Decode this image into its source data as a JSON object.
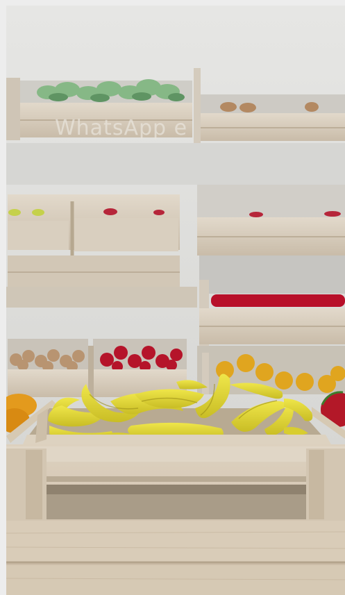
{
  "watermark": {
    "text": "WhatsApp e"
  },
  "colors": {
    "wall": "#d9dad8",
    "crate_wood": "#d7cdbe",
    "crate_shadow": "#a79b89",
    "banana": "#e6dc3a",
    "banana_shade": "#b7a91f",
    "red_fruit": "#b5142a",
    "orange_fruit": "#e39a1d",
    "green_produce": "#7fb27d",
    "onion": "#b89471"
  }
}
